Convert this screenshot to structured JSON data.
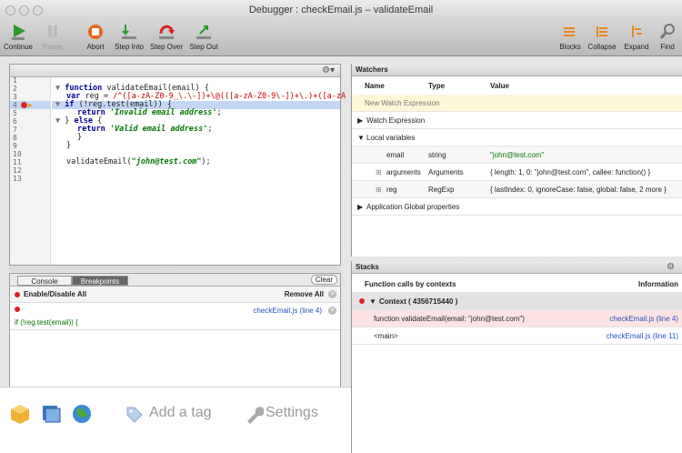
{
  "window": {
    "title": "Debugger : checkEmail.js – validateEmail"
  },
  "toolbar": {
    "left": [
      {
        "label": "Continue",
        "icon": "continue-icon",
        "enabled": true
      },
      {
        "label": "Pause",
        "icon": "pause-icon",
        "enabled": false
      },
      {
        "label": "Abort",
        "icon": "abort-icon",
        "enabled": true
      },
      {
        "label": "Step Into",
        "icon": "step-into-icon",
        "enabled": true
      },
      {
        "label": "Step Over",
        "icon": "step-over-icon",
        "enabled": true
      },
      {
        "label": "Step Out",
        "icon": "step-out-icon",
        "enabled": true
      }
    ],
    "right": [
      {
        "label": "Blocks",
        "icon": "blocks-icon"
      },
      {
        "label": "Collapse",
        "icon": "collapse-icon"
      },
      {
        "label": "Expand",
        "icon": "expand-icon"
      },
      {
        "label": "Find",
        "icon": "find-icon"
      }
    ]
  },
  "editor": {
    "line_numbers": [
      "1",
      "2",
      "3",
      "4",
      "5",
      "6",
      "7",
      "8",
      "9",
      "10",
      "11",
      "12",
      "13"
    ],
    "current_line": "4",
    "code": {
      "l2_kw": "function",
      "l2_rest": " validateEmail(email) {",
      "l3_kw": "var",
      "l3_name": " reg = ",
      "l3_re": "/^([a-zA-Z0-9_\\.\\-])+\\@(([a-zA-Z0-9\\-])+\\.)+([a-zA",
      "l4_kw": "if",
      "l4_rest": " (!reg.test(email)) {",
      "l5_kw": "return",
      "l5_str": "'Invalid email address'",
      "l5_end": ";",
      "l6_a": "} ",
      "l6_kw": "else",
      "l6_b": " {",
      "l7_kw": "return",
      "l7_str": "'Valid email address'",
      "l7_end": ";",
      "l8": "}",
      "l9": "}",
      "l11_a": "validateEmail(",
      "l11_str": "\"john@test.com\"",
      "l11_b": ");"
    }
  },
  "breakpoints_panel": {
    "tabs": [
      "Console",
      "Breakpoints"
    ],
    "active_tab": "Breakpoints",
    "clear_label": "Clear",
    "enable_disable_label": "Enable/Disable All",
    "remove_all_label": "Remove All",
    "items": [
      {
        "location": "checkEmail.js (line 4)",
        "code": "if (!reg.test(email)) {"
      }
    ]
  },
  "watchers": {
    "title": "Watchers",
    "columns": [
      "Name",
      "Type",
      "Value"
    ],
    "new_watch_placeholder": "New Watch Expression",
    "sections": {
      "watch_expression": "Watch Expression",
      "local_variables": "Local variables",
      "app_global": "Application Global properties"
    },
    "rows": [
      {
        "name": "email",
        "type": "string",
        "value": "\"john@test.com\""
      },
      {
        "name": "arguments",
        "type": "Arguments",
        "value": "{ length: 1, 0: \"john@test.com\", callee: function() }"
      },
      {
        "name": "reg",
        "type": "RegExp",
        "value": "{ lastIndex: 0, ignoreCase: false, global: false, 2 more }"
      }
    ]
  },
  "stacks": {
    "title": "Stacks",
    "columns": [
      "Function calls by contexts",
      "Information"
    ],
    "context_label": "Context ( 4356715440 )",
    "frames": [
      {
        "function": "function validateEmail(email: \"john@test.com\")",
        "info": "checkEmail.js (line 4)"
      },
      {
        "function": "<main>",
        "info": "checkEmail.js (line 11)"
      }
    ]
  },
  "overlay": {
    "add_tag_label": "Add a tag",
    "settings_label": "Settings"
  },
  "colors": {
    "accent_red": "#d22222",
    "highlight_blue": "#c4d6f5",
    "string_green": "#007700",
    "link_blue": "#2050c0"
  }
}
